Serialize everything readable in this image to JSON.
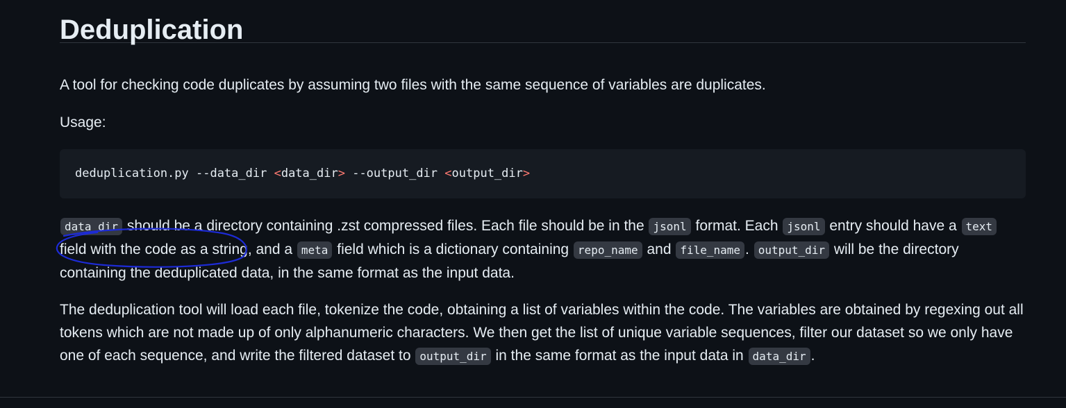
{
  "heading": "Deduplication",
  "intro": "A tool for checking code duplicates by assuming two files with the same sequence of variables are duplicates.",
  "usage_label": "Usage:",
  "code": {
    "cmd": "deduplication.py --data_dir ",
    "arg1_open": "<",
    "arg1": "data_dir",
    "arg1_close": ">",
    "mid": " --output_dir ",
    "arg2_open": "<",
    "arg2": "output_dir",
    "arg2_close": ">"
  },
  "desc": {
    "c1": "data_dir",
    "t1": " should be a directory containing .zst compressed files. Each file should be in the ",
    "c2": "jsonl",
    "t2": " format. Each ",
    "c3": "jsonl",
    "t3": " entry should have a ",
    "c4": "text",
    "t4": " field with the code as a string, and a ",
    "c5": "meta",
    "t5": " field which is a dictionary containing ",
    "c6": "repo_name",
    "t6": " and ",
    "c7": "file_name",
    "t7": ". ",
    "c8": "output_dir",
    "t8": " will be the directory containing the deduplicated data, in the same format as the input data."
  },
  "tool": {
    "t1": "The deduplication tool will load each file, tokenize the code, obtaining a list of variables within the code. The variables are obtained by regexing out all tokens which are not made up of only alphanumeric characters. We then get the list of unique variable sequences, filter our dataset so we only have one of each sequence, and write the filtered dataset to ",
    "c1": "output_dir",
    "t2": " in the same format as the input data in ",
    "c2": "data_dir",
    "t3": "."
  },
  "colors": {
    "background": "#0d1117",
    "text": "#e6edf3",
    "inline_code_bg": "#343942",
    "code_block_bg": "#161b22",
    "angle_bracket": "#ff7b72",
    "annotation_ink": "#1d2bd6"
  }
}
